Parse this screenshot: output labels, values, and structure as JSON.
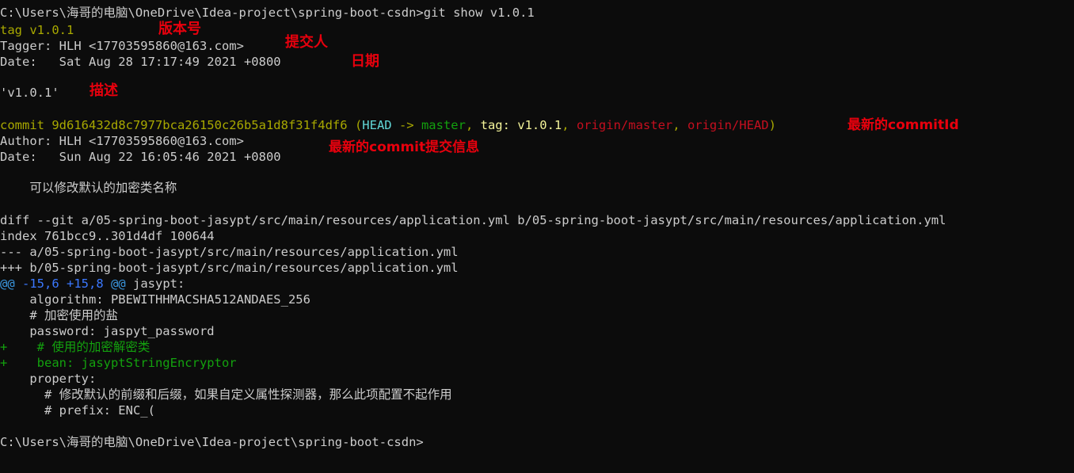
{
  "terminal": {
    "background": "#0c0c0c",
    "foreground": "#cccccc",
    "colors": {
      "white": "#cccccc",
      "yellow": "#a8a800",
      "bright_yellow": "#f3f399",
      "green": "#13a10e",
      "cyan": "#61d6d6",
      "red": "#c50f1f",
      "blue": "#3b78ff",
      "annotation_red": "#e8000d"
    },
    "prompt_path": "C:\\Users\\海哥的电脑\\OneDrive\\Idea-project\\spring-boot-csdn",
    "command": "git show v1.0.1"
  },
  "lines": {
    "prompt_command": {
      "path": "C:\\Users\\海哥的电脑\\OneDrive\\Idea-project\\spring-boot-csdn>",
      "command": "git show v1.0.1"
    },
    "tag_line": "tag v1.0.1",
    "tagger_line": "Tagger: HLH <17703595860@163.com>",
    "tag_date_line": "Date:   Sat Aug 28 17:17:49 2021 +0800",
    "tag_message": "'v1.0.1'",
    "commit": {
      "keyword": "commit ",
      "hash": "9d616432d8c7977bca26150c26b5a1d8f31f4df6",
      "paren_open": " (",
      "head": "HEAD",
      "arrow": " -> ",
      "master": "master",
      "sep1": ", ",
      "tag_label": "tag: v1.0.1",
      "sep2": ", ",
      "origin_master": "origin/master",
      "sep3": ", ",
      "origin_head": "origin/HEAD",
      "paren_close": ")"
    },
    "author_line": "Author: HLH <17703595860@163.com>",
    "commit_date_line": "Date:   Sun Aug 22 16:05:46 2021 +0800",
    "commit_message": "    可以修改默认的加密类名称",
    "diff_git": "diff --git a/05-spring-boot-jasypt/src/main/resources/application.yml b/05-spring-boot-jasypt/src/main/resources/application.yml",
    "index_line": "index 761bcc9..301d4df 100644",
    "minus_file": "--- a/05-spring-boot-jasypt/src/main/resources/application.yml",
    "plus_file": "+++ b/05-spring-boot-jasypt/src/main/resources/application.yml",
    "hunk": {
      "at_open": "@@ ",
      "range": "-15,6 +15,8",
      "at_close": " @@",
      "context": " jasypt:"
    },
    "yaml_algorithm": "    algorithm: PBEWITHHMACSHA512ANDAES_256",
    "yaml_salt_comment": "    # 加密使用的盐",
    "yaml_password": "    password: jaspyt_password",
    "added_comment": "+    # 使用的加密解密类",
    "added_bean": "+    bean: jasyptStringEncryptor",
    "yaml_property": "    property:",
    "yaml_prefix_comment": "      # 修改默认的前缀和后缀，如果自定义属性探测器，那么此项配置不起作用",
    "yaml_prefix": "      # prefix: ENC_(",
    "final_prompt": "C:\\Users\\海哥的电脑\\OneDrive\\Idea-project\\spring-boot-csdn>"
  },
  "annotations": {
    "version_number": "版本号",
    "committer": "提交人",
    "date": "日期",
    "description": "描述",
    "latest_commit_id": "最新的commitId",
    "latest_commit_info": "最新的commit提交信息"
  }
}
